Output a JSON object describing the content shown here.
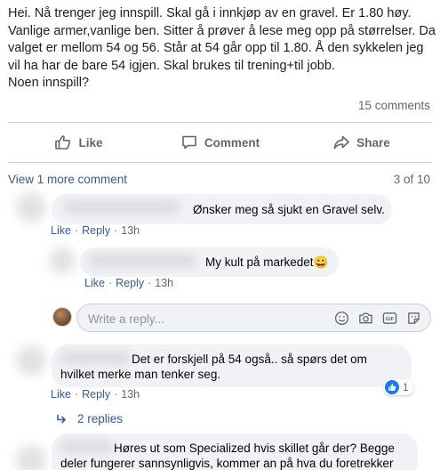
{
  "post": {
    "lines": [
      "Hei. Nå trenger jeg innspill. Skal gå i innkjøp av en gravel. Er 1.80 høy.",
      "Vanlige armer,vanlige ben. Sitter å prøver å lese meg opp på størrelser. Da",
      "valget er mellom 54 og 56. Står at 54 går opp til 1.80. Å den sykkelen jeg",
      "vil ha har de bare 54 igjen. Skal brukes til trening+til jobb.",
      "Noen innspill?"
    ],
    "comments_count": "15 comments"
  },
  "actions": {
    "like_label": "Like",
    "comment_label": "Comment",
    "share_label": "Share",
    "like_icon": "thumbs-up-icon",
    "comment_icon": "speech-bubble-icon",
    "share_icon": "share-arrow-icon"
  },
  "comments_header": {
    "view_more": "View 1 more comment",
    "count": "3 of 10"
  },
  "comments": [
    {
      "text": "Ønsker meg så sjukt en Gravel selv.",
      "like": "Like",
      "reply": "Reply",
      "time": "13h"
    },
    {
      "text": "My kult på markedet😀",
      "like": "Like",
      "reply": "Reply",
      "time": "13h"
    },
    {
      "text_line1": "Det er forskjell på 54 også.. så spørs det om",
      "text_line2": "hvilket merke man tenker seg.",
      "like": "Like",
      "reply": "Reply",
      "time": "13h",
      "reaction_count": "1",
      "replies_label": "2 replies"
    },
    {
      "text_line1": "Høres ut som Specialized hvis skillet går der? Begge",
      "text_line2": "deler fungerer sannsynligvis, kommer an på hva du foretrekker"
    }
  ],
  "reply_box": {
    "placeholder": "Write a reply...",
    "icons": [
      "smiley-icon",
      "camera-icon",
      "gif-icon",
      "sticker-icon"
    ]
  },
  "colors": {
    "link": "#385898",
    "muted": "#65676b",
    "bubble": "#f0f2f5",
    "like_blue": "#1877f2"
  }
}
